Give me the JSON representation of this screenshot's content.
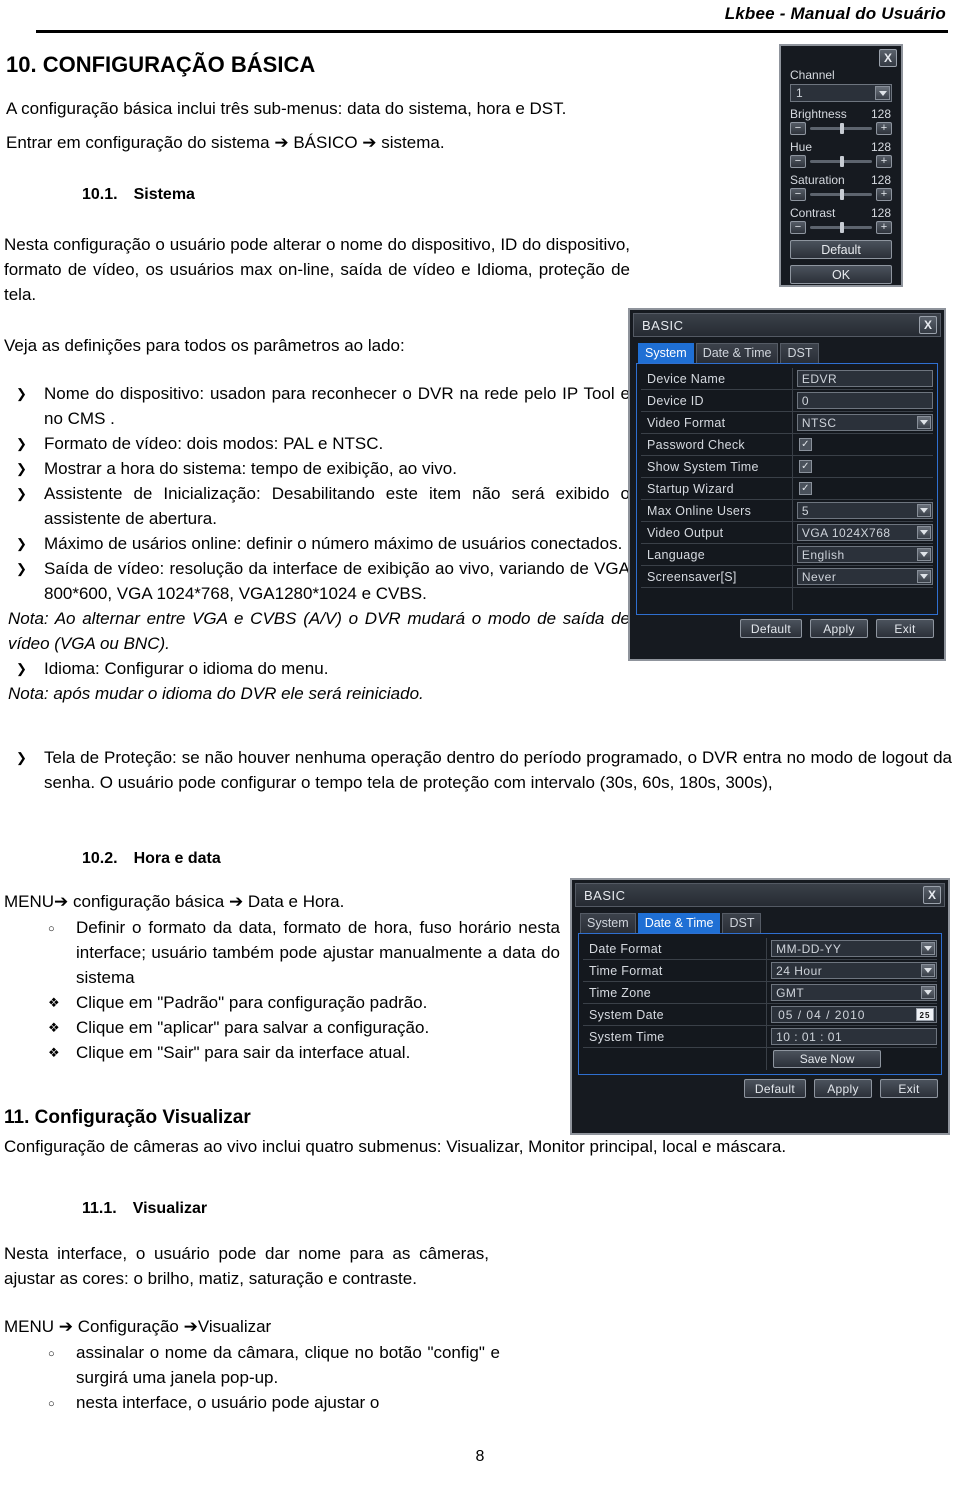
{
  "header": {
    "running_head": "Lkbee - Manual do Usuário"
  },
  "page_number": "8",
  "sections": {
    "s10_title": "10. CONFIGURAÇÃO BÁSICA",
    "s10_intro_l1": "A configuração básica inclui três sub-menus: data do sistema, hora e DST.",
    "s10_intro_l2": "Entrar em configuração do sistema ➔ BÁSICO ➔ sistema.",
    "s10_1_title": "10.1. Sistema",
    "s10_1_para": "Nesta configuração o usuário pode alterar o nome do dispositivo, ID do dispositivo, formato de vídeo, os usuários max on-line, saída de vídeo e Idioma, proteção de tela.",
    "s10_1_lead": "Veja as definições para todos os parâmetros ao lado:",
    "s10_2_title": "10.2. Hora e data",
    "s10_2_menu": "MENU➔ configuração básica ➔ Data e Hora.",
    "s11_title": "11. Configuração Visualizar",
    "s11_para": "Configuração de câmeras ao vivo inclui quatro submenus: Visualizar, Monitor principal, local e máscara.",
    "s11_1_title": "11.1. Visualizar",
    "s11_1_para": "Nesta interface, o usuário pode dar nome para as câmeras, ajustar as cores: o brilho, matiz, saturação e contraste.",
    "s11_1_menu": "MENU ➔ Configuração ➔Visualizar"
  },
  "bullets_10_1": [
    {
      "bullet": "arrow",
      "text": "Nome do dispositivo: usadon para reconhecer o DVR na rede pelo IP Tool e no CMS ."
    },
    {
      "bullet": "arrow",
      "text": "Formato de vídeo: dois modos: PAL e NTSC."
    },
    {
      "bullet": "arrow",
      "text": "Mostrar a hora do sistema: tempo de exibição, ao vivo."
    },
    {
      "bullet": "arrow",
      "text": "Assistente de Inicialização: Desabilitando este item não será exibido o assistente de abertura."
    },
    {
      "bullet": "arrow",
      "text": "Máximo de usários online: definir o número máximo de usuários conectados."
    },
    {
      "bullet": "arrow",
      "text": "Saída de vídeo: resolução da interface de exibição ao vivo, variando de VGA 800*600, VGA 1024*768, VGA1280*1024 e CVBS."
    },
    {
      "bullet": "none",
      "italic": true,
      "text": "Nota: Ao alternar entre VGA e CVBS (A/V) o DVR mudará o modo de saída de vídeo (VGA ou BNC)."
    },
    {
      "bullet": "arrow",
      "text": "Idioma: Configurar o idioma do menu."
    },
    {
      "bullet": "none",
      "italic": true,
      "text": "Nota: após mudar o idioma do DVR ele será reiniciado."
    }
  ],
  "bullet_screensaver": {
    "bullet": "arrow",
    "text": "Tela de Proteção: se não houver nenhuma operação dentro do período programado, o DVR entra no modo de logout da senha. O usuário pode configurar o tempo tela de proteção com intervalo (30s, 60s, 180s, 300s),"
  },
  "bullets_10_2": [
    {
      "bullet": "circ",
      "text": "Definir o formato da data, formato de hora, fuso horário nesta interface; usuário também pode ajustar manualmente a data do sistema"
    },
    {
      "bullet": "diam",
      "text": "Clique em \"Padrão\" para configuração padrão."
    },
    {
      "bullet": "diam",
      "text": "Clique em \"aplicar\" para salvar a configuração."
    },
    {
      "bullet": "diam",
      "text": "Clique em \"Sair\" para sair da interface atual."
    }
  ],
  "bullets_11_1": [
    {
      "bullet": "circ",
      "text": "assinalar o nome da câmara, clique no botão  \"config\" e surgirá uma janela pop-up."
    },
    {
      "bullet": "circ",
      "text": "nesta interface, o usuário pode ajustar o"
    }
  ],
  "channel_panel": {
    "close_label": "X",
    "channel_label": "Channel",
    "channel_value": "1",
    "sliders": [
      {
        "label": "Brightness",
        "value": "128"
      },
      {
        "label": "Hue",
        "value": "128"
      },
      {
        "label": "Saturation",
        "value": "128"
      },
      {
        "label": "Contrast",
        "value": "128"
      }
    ],
    "minus_label": "−",
    "plus_label": "+",
    "default_label": "Default",
    "ok_label": "OK"
  },
  "basic_system_dialog": {
    "title": "BASIC",
    "close_label": "X",
    "tabs": [
      {
        "label": "System",
        "active": true
      },
      {
        "label": "Date & Time",
        "active": false
      },
      {
        "label": "DST",
        "active": false
      }
    ],
    "fields": [
      {
        "label": "Device Name",
        "type": "text",
        "value": "EDVR"
      },
      {
        "label": "Device ID",
        "type": "text",
        "value": "0"
      },
      {
        "label": "Video Format",
        "type": "select",
        "value": "NTSC"
      },
      {
        "label": "Password Check",
        "type": "check",
        "value": "✓"
      },
      {
        "label": "Show System Time",
        "type": "check",
        "value": "✓"
      },
      {
        "label": "Startup Wizard",
        "type": "check",
        "value": "✓"
      },
      {
        "label": "Max Online Users",
        "type": "select",
        "value": "5"
      },
      {
        "label": "Video Output",
        "type": "select",
        "value": "VGA 1024X768"
      },
      {
        "label": "Language",
        "type": "select",
        "value": "English"
      },
      {
        "label": "Screensaver[S]",
        "type": "select",
        "value": "Never"
      },
      {
        "label": "",
        "type": "blank",
        "value": ""
      }
    ],
    "buttons": [
      "Default",
      "Apply",
      "Exit"
    ]
  },
  "basic_datetime_dialog": {
    "title": "BASIC",
    "close_label": "X",
    "tabs": [
      {
        "label": "System",
        "active": false
      },
      {
        "label": "Date & Time",
        "active": true
      },
      {
        "label": "DST",
        "active": false
      }
    ],
    "fields": [
      {
        "label": "Date Format",
        "type": "select",
        "value": "MM-DD-YY"
      },
      {
        "label": "Time Format",
        "type": "select",
        "value": "24 Hour"
      },
      {
        "label": "Time Zone",
        "type": "select",
        "value": "GMT"
      },
      {
        "label": "System Date",
        "type": "date",
        "value": "05 / 04 / 2010"
      },
      {
        "label": "System Time",
        "type": "text",
        "value": "10 : 01 : 01"
      },
      {
        "label": "",
        "type": "button",
        "value": "Save Now"
      }
    ],
    "buttons": [
      "Default",
      "Apply",
      "Exit"
    ],
    "calendar_icon_label": "25"
  }
}
